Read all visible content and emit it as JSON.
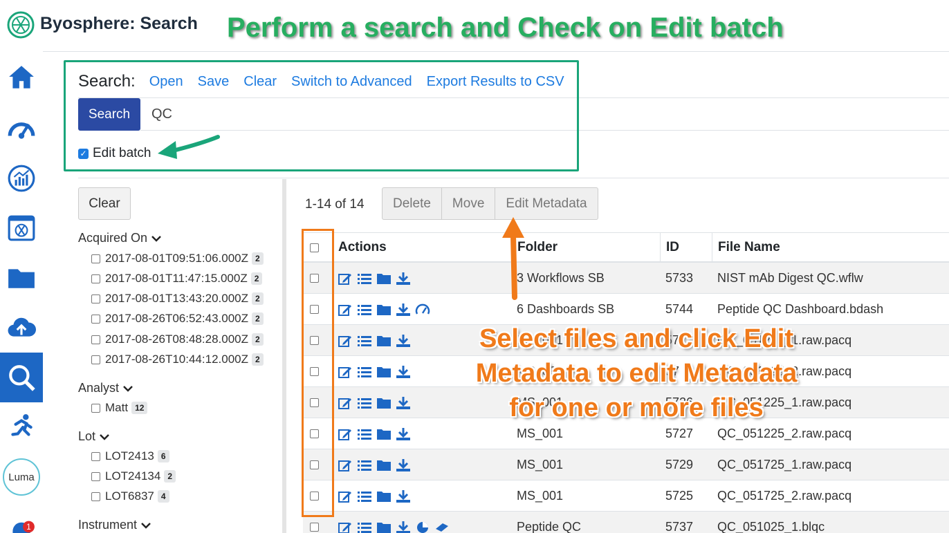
{
  "app": {
    "title": "Byosphere: Search",
    "brand_color": "#1d67c4"
  },
  "sidebar": {
    "items": [
      {
        "name": "home",
        "icon": "home-icon"
      },
      {
        "name": "dashboards",
        "icon": "gauge-icon"
      },
      {
        "name": "analytics",
        "icon": "analytics-icon"
      },
      {
        "name": "apps",
        "icon": "app-window-icon"
      },
      {
        "name": "files",
        "icon": "folder-icon"
      },
      {
        "name": "upload",
        "icon": "cloud-upload-icon"
      },
      {
        "name": "search",
        "icon": "search-icon",
        "active": true
      },
      {
        "name": "runs",
        "icon": "runner-icon"
      },
      {
        "name": "luma",
        "label": "Luma"
      },
      {
        "name": "notifications",
        "icon": "bell-icon",
        "badge": "1"
      }
    ]
  },
  "annotations": {
    "top": "Perform a search and Check on Edit batch",
    "middle_lines": [
      "Select files and click Edit",
      "Metadata to edit Metadata",
      "for one or more files"
    ]
  },
  "search": {
    "label": "Search:",
    "links": {
      "open": "Open",
      "save": "Save",
      "clear": "Clear",
      "advanced": "Switch to Advanced",
      "export": "Export Results to CSV"
    },
    "button": "Search",
    "query": "QC",
    "edit_batch_label": "Edit batch",
    "edit_batch_checked": true
  },
  "facets": {
    "clear_label": "Clear",
    "acquired_on": {
      "title": "Acquired On",
      "items": [
        {
          "label": "2017-08-01T09:51:06.000Z",
          "count": "2"
        },
        {
          "label": "2017-08-01T11:47:15.000Z",
          "count": "2"
        },
        {
          "label": "2017-08-01T13:43:20.000Z",
          "count": "2"
        },
        {
          "label": "2017-08-26T06:52:43.000Z",
          "count": "2"
        },
        {
          "label": "2017-08-26T08:48:28.000Z",
          "count": "2"
        },
        {
          "label": "2017-08-26T10:44:12.000Z",
          "count": "2"
        }
      ]
    },
    "analyst": {
      "title": "Analyst",
      "items": [
        {
          "label": "Matt",
          "count": "12"
        }
      ]
    },
    "lot": {
      "title": "Lot",
      "items": [
        {
          "label": "LOT2413",
          "count": "6"
        },
        {
          "label": "LOT24134",
          "count": "2"
        },
        {
          "label": "LOT6837",
          "count": "4"
        }
      ]
    },
    "instrument": {
      "title": "Instrument"
    }
  },
  "results": {
    "count_text": "1-14 of 14",
    "buttons": {
      "delete": "Delete",
      "move": "Move",
      "edit_metadata": "Edit Metadata"
    },
    "columns": {
      "actions": "Actions",
      "folder": "Folder",
      "id": "ID",
      "file_name": "File Name"
    },
    "rows": [
      {
        "folder": "3 Workflows SB",
        "id": "5733",
        "file": "NIST mAb Digest QC.wflw"
      },
      {
        "folder": "6 Dashboards SB",
        "id": "5744",
        "file": "Peptide QC Dashboard.bdash"
      },
      {
        "folder": "MS_001",
        "id": "57",
        "file": "QC_051225_1.raw.pacq"
      },
      {
        "folder": "MS_001",
        "id": "57",
        "file": "QC_051225_2.raw.pacq"
      },
      {
        "folder": "MS_001",
        "id": "5726",
        "file": "QC_051225_1.raw.pacq"
      },
      {
        "folder": "MS_001",
        "id": "5727",
        "file": "QC_051225_2.raw.pacq"
      },
      {
        "folder": "MS_001",
        "id": "5729",
        "file": "QC_051725_1.raw.pacq"
      },
      {
        "folder": "MS_001",
        "id": "5725",
        "file": "QC_051725_2.raw.pacq"
      },
      {
        "folder": "Peptide QC",
        "id": "5737",
        "file": "QC_051025_1.blqc"
      }
    ]
  },
  "colors": {
    "annotation_green": "#27ae60",
    "annotation_orange": "#f07a1a",
    "link": "#1d7be0",
    "search_button": "#2b4aa3"
  }
}
